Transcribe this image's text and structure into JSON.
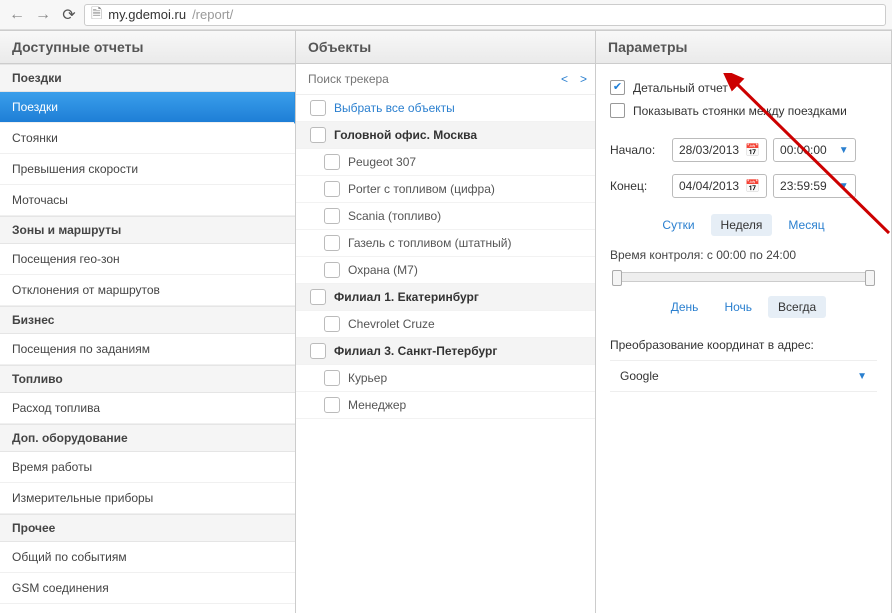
{
  "browser": {
    "url_host": "my.gdemoi.ru",
    "url_path": "/report/"
  },
  "panels": {
    "reports": "Доступные отчеты",
    "objects": "Объекты",
    "params": "Параметры"
  },
  "reports": {
    "groups": [
      {
        "title": "Поездки",
        "items": [
          {
            "label": "Поездки",
            "selected": true
          },
          {
            "label": "Стоянки"
          },
          {
            "label": "Превышения скорости"
          },
          {
            "label": "Моточасы"
          }
        ]
      },
      {
        "title": "Зоны и маршруты",
        "items": [
          {
            "label": "Посещения гео-зон"
          },
          {
            "label": "Отклонения от маршрутов"
          }
        ]
      },
      {
        "title": "Бизнес",
        "items": [
          {
            "label": "Посещения по заданиям"
          }
        ]
      },
      {
        "title": "Топливо",
        "items": [
          {
            "label": "Расход топлива"
          }
        ]
      },
      {
        "title": "Доп. оборудование",
        "items": [
          {
            "label": "Время работы"
          },
          {
            "label": "Измерительные приборы"
          }
        ]
      },
      {
        "title": "Прочее",
        "items": [
          {
            "label": "Общий по событиям"
          },
          {
            "label": "GSM соединения"
          }
        ]
      }
    ]
  },
  "objects": {
    "search_placeholder": "Поиск трекера",
    "select_all": "Выбрать все объекты",
    "tree": [
      {
        "type": "group",
        "label": "Головной офис. Москва"
      },
      {
        "type": "item",
        "label": "Peugeot 307"
      },
      {
        "type": "item",
        "label": "Porter с топливом (цифра)"
      },
      {
        "type": "item",
        "label": "Scania (топливо)"
      },
      {
        "type": "item",
        "label": "Газель с топливом (штатный)"
      },
      {
        "type": "item",
        "label": "Охрана (М7)"
      },
      {
        "type": "group",
        "label": "Филиал 1. Екатеринбург"
      },
      {
        "type": "item",
        "label": "Chevrolet Cruze"
      },
      {
        "type": "group",
        "label": "Филиал 3. Санкт-Петербург"
      },
      {
        "type": "item",
        "label": "Курьер"
      },
      {
        "type": "item",
        "label": "Менеджер"
      }
    ]
  },
  "params": {
    "detailed_label": "Детальный отчет",
    "show_stops_label": "Показывать стоянки между поездками",
    "start_label": "Начало:",
    "end_label": "Конец:",
    "start_date": "28/03/2013",
    "start_time": "00:00:00",
    "end_date": "04/04/2013",
    "end_time": "23:59:59",
    "range_day": "Сутки",
    "range_week": "Неделя",
    "range_month": "Месяц",
    "control_time_label": "Время контроля: с 00:00 по 24:00",
    "period_day": "День",
    "period_night": "Ночь",
    "period_always": "Всегда",
    "coord_label": "Преобразование координат в адрес:",
    "geocoder": "Google"
  }
}
